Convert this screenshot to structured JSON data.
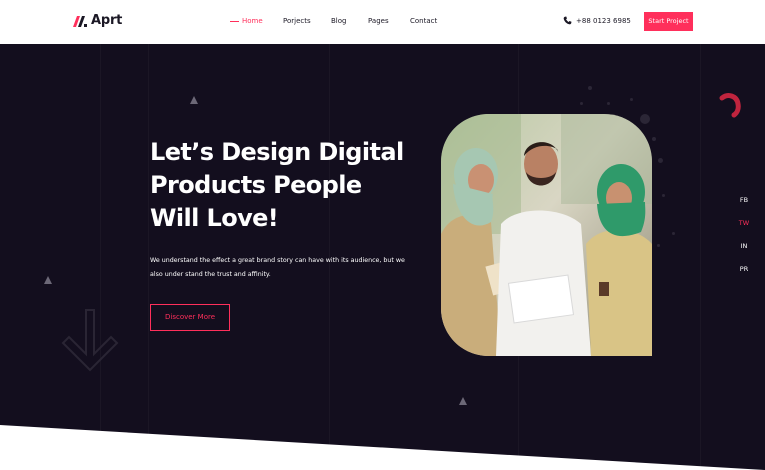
{
  "header": {
    "logo_text": "Aprt",
    "nav": [
      {
        "label": "Home",
        "active": true
      },
      {
        "label": "Porjects",
        "active": false
      },
      {
        "label": "Blog",
        "active": false
      },
      {
        "label": "Pages",
        "active": false
      },
      {
        "label": "Contact",
        "active": false
      }
    ],
    "phone": "+88 0123 6985",
    "cta_label": "Start Project"
  },
  "hero": {
    "title_lines": [
      "Let’s Design Digital",
      "Products People",
      "Will Love!"
    ],
    "description": "We understand the effect a great brand story can have with its audience, but we also under stand the trust and affinity.",
    "button_label": "Discover More"
  },
  "social": [
    {
      "label": "FB",
      "active": false
    },
    {
      "label": "TW",
      "active": true
    },
    {
      "label": "IN",
      "active": false
    },
    {
      "label": "PR",
      "active": false
    }
  ],
  "colors": {
    "accent": "#ff2f5b",
    "hero_background": "#130e1e",
    "header_background": "#ffffff"
  },
  "icons": {
    "logo": "aprt-logo-mark",
    "phone": "phone-icon",
    "decorative": [
      "triangle-icon",
      "arrow-down-icon",
      "ring-arc-icon"
    ]
  }
}
